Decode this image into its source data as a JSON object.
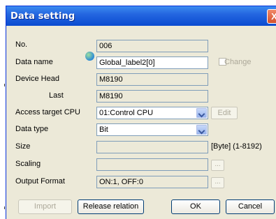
{
  "dialog": {
    "title": "Data setting",
    "close_label": "X"
  },
  "fields": {
    "no_label": "No.",
    "no_value": "006",
    "data_name_label": "Data name",
    "data_name_value": "Global_label2[0]",
    "change_label": "Change",
    "device_head_label": "Device Head",
    "device_head_value": "M8190",
    "last_label": "Last",
    "last_value": "M8190",
    "access_cpu_label": "Access target CPU",
    "access_cpu_value": "01:Control CPU",
    "edit_label": "Edit",
    "data_type_label": "Data type",
    "data_type_value": "Bit",
    "size_label": "Size",
    "size_value": "",
    "size_unit": "[Byte] (1-8192)",
    "scaling_label": "Scaling",
    "scaling_value": "",
    "output_format_label": "Output Format",
    "output_format_value": "ON:1, OFF:0",
    "ellipsis": "..."
  },
  "buttons": {
    "import": "Import",
    "release_relation": "Release relation",
    "ok": "OK",
    "cancel": "Cancel"
  },
  "icons": {
    "data_name_icon": "globe-icon",
    "dropdown_icon": "chevron-down-icon"
  }
}
